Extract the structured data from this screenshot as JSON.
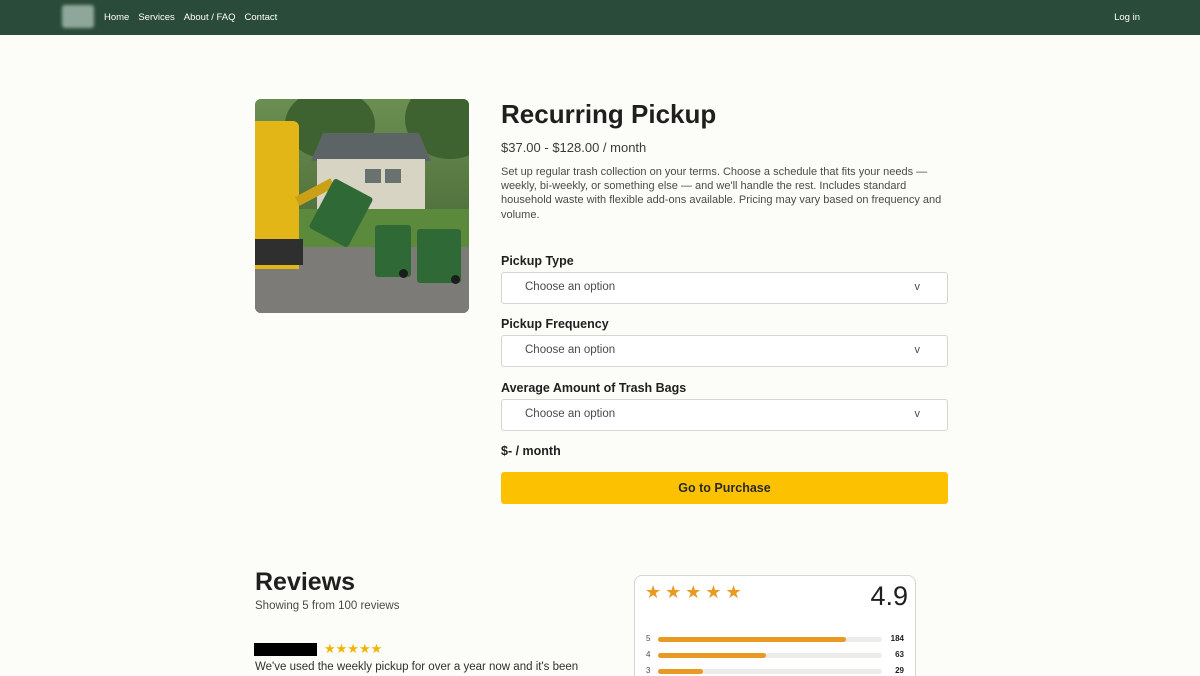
{
  "nav": {
    "links": [
      "Home",
      "Services",
      "About / FAQ",
      "Contact"
    ],
    "login": "Log in"
  },
  "product": {
    "title": "Recurring Pickup",
    "price_range": "$37.00 - $128.00 / month",
    "description": "Set up regular trash collection on your terms. Choose a schedule that fits your needs — weekly, bi-weekly, or something else — and we'll handle the rest. Includes standard household waste with flexible add-ons available. Pricing may vary based on frequency and volume.",
    "fields": [
      {
        "label": "Pickup Type",
        "placeholder": "Choose an option"
      },
      {
        "label": "Pickup Frequency",
        "placeholder": "Choose an option"
      },
      {
        "label": "Average Amount of Trash Bags",
        "placeholder": "Choose an option"
      }
    ],
    "chevron": "v",
    "price_total": "$- / month",
    "purchase_label": "Go to Purchase"
  },
  "reviews": {
    "title": "Reviews",
    "subtitle": "Showing 5 from 100 reviews",
    "first_review": {
      "stars": "★★★★★",
      "text": "We've used the weekly pickup for over a year now and it's been"
    },
    "summary": {
      "stars": "★★★★★",
      "score": "4.9",
      "rows": [
        {
          "label": "5",
          "count": "184",
          "fill": 0.84
        },
        {
          "label": "4",
          "count": "63",
          "fill": 0.48
        },
        {
          "label": "3",
          "count": "29",
          "fill": 0.2
        }
      ]
    }
  },
  "colors": {
    "nav_bg": "#2b4b3a",
    "accent": "#fcc100",
    "star": "#e89a22"
  }
}
